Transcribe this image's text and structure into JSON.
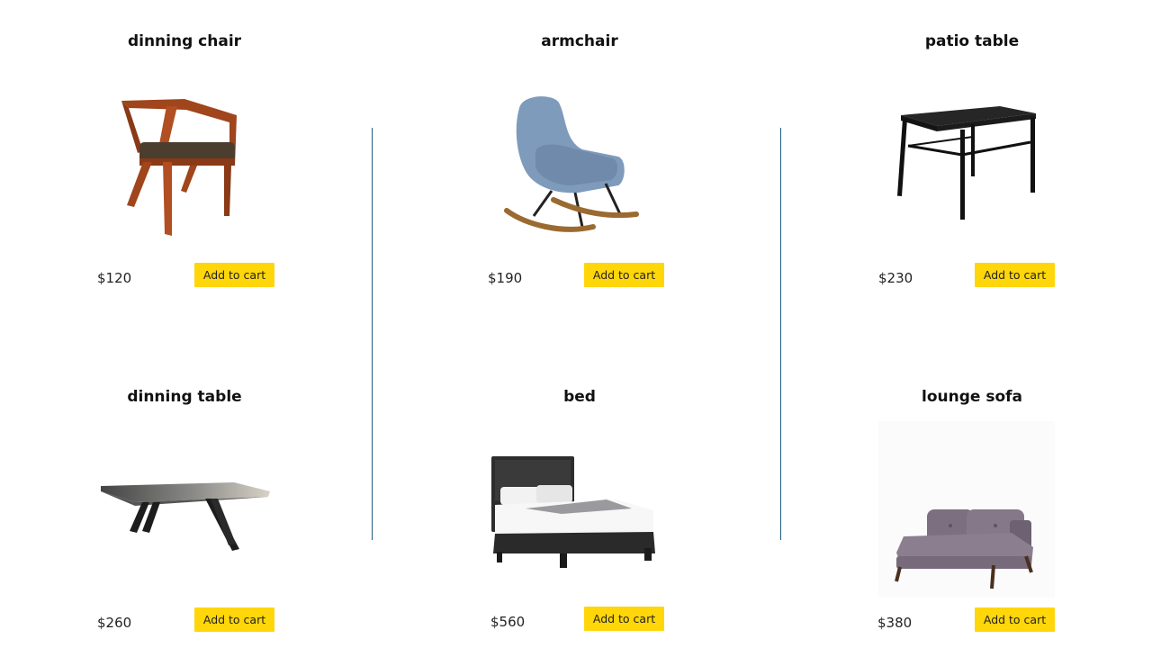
{
  "button_label": "Add to cart",
  "colors": {
    "button": "#ffd60a",
    "divider": "#1f5d80"
  },
  "products": [
    {
      "name": "dinning chair",
      "price": "$120",
      "image": "dining-chair-image"
    },
    {
      "name": "armchair",
      "price": "$190",
      "image": "rocking-armchair-image"
    },
    {
      "name": "patio table",
      "price": "$230",
      "image": "patio-table-image"
    },
    {
      "name": "dinning table",
      "price": "$260",
      "image": "dining-table-image"
    },
    {
      "name": "bed",
      "price": "$560",
      "image": "bed-image"
    },
    {
      "name": "lounge sofa",
      "price": "$380",
      "image": "lounge-sofa-image"
    }
  ]
}
